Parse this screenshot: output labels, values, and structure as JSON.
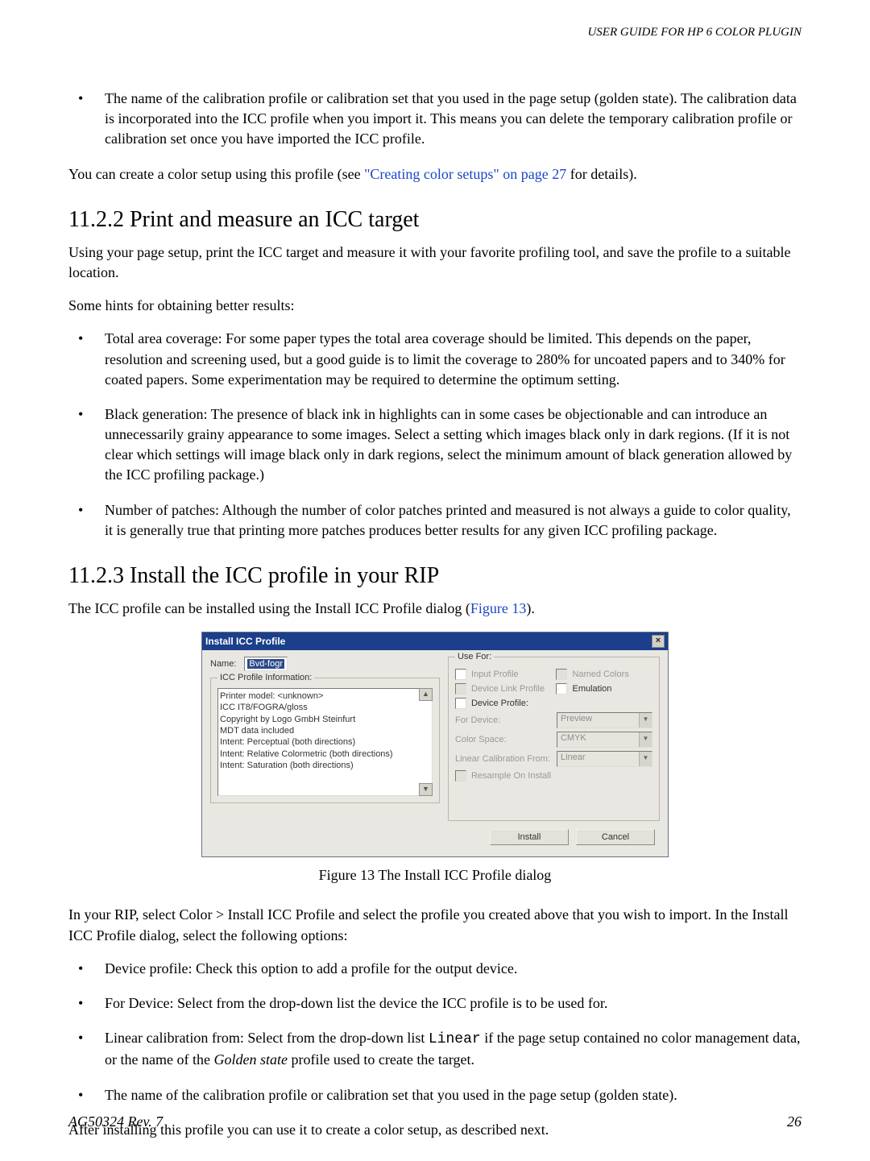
{
  "running_header": "USER GUIDE FOR HP 6 COLOR PLUGIN",
  "intro_bullet": "The name of the calibration profile or calibration set that you used in the page setup (golden state). The calibration data is incorporated into the ICC profile when you import it. This means you can delete the temporary calibration profile or calibration set once you have imported the ICC profile.",
  "create_setup_pre": "You can create a color setup using this profile (see ",
  "create_setup_link": "\"Creating color setups\" on page 27",
  "create_setup_post": " for details).",
  "sec_1122_title": "11.2.2   Print and measure an ICC target",
  "sec_1122_p1": "Using your page setup, print the ICC target and measure it with your favorite profiling tool, and save the profile to a suitable location.",
  "sec_1122_p2": "Some hints for obtaining better results:",
  "sec_1122_bullets": [
    "Total area coverage: For some paper types the total area coverage should be limited. This depends on the paper, resolution and screening used, but a good guide is to limit the coverage to 280% for uncoated papers and to 340% for coated papers. Some experimentation may be required to determine the optimum setting.",
    "Black generation: The presence of black ink in highlights can in some cases be objectionable and can introduce an unnecessarily grainy appearance to some images. Select a setting which images black only in dark regions. (If it is not clear which settings will image black only in dark regions, select the minimum amount of black generation allowed by the ICC profiling package.)",
    "Number of patches: Although the number of color patches printed and measured is not always a guide to color quality, it is generally true that printing more patches produces better results for any given ICC profiling package."
  ],
  "sec_1123_title": "11.2.3   Install the ICC profile in your RIP",
  "sec_1123_p1_pre": "The ICC profile can be installed using the Install ICC Profile dialog (",
  "sec_1123_p1_link": "Figure 13",
  "sec_1123_p1_post": ").",
  "dialog": {
    "title": "Install ICC Profile",
    "name_label": "Name:",
    "name_value": "Bvd-fogr",
    "icc_group_legend": "ICC Profile Information:",
    "icc_info_lines": [
      "Printer model: <unknown>",
      "ICC IT8/FOGRA/gloss",
      "Copyright by Logo GmbH Steinfurt",
      "MDT data included",
      "Intent: Perceptual (both directions)",
      "Intent: Relative Colormetric (both directions)",
      "Intent: Saturation (both directions)"
    ],
    "use_for_legend": "Use For:",
    "input_profile": "Input Profile",
    "named_colors": "Named Colors",
    "device_link_profile": "Device Link Profile",
    "emulation": "Emulation",
    "device_profile": "Device Profile:",
    "for_device_label": "For Device:",
    "for_device_value": "Preview",
    "color_space_label": "Color Space:",
    "color_space_value": "CMYK",
    "linear_cal_label": "Linear Calibration From:",
    "linear_cal_value": "Linear",
    "resample": "Resample On Install",
    "install_btn": "Install",
    "cancel_btn": "Cancel"
  },
  "figure_caption": "Figure 13    The Install ICC Profile dialog",
  "sec_1123_p2": "In your RIP, select Color > Install ICC Profile and select the profile you created above that you wish to import. In the Install ICC Profile dialog, select the following options:",
  "sec_1123_bullets": {
    "b1": "Device profile: Check this option to add a profile for the output device.",
    "b2": "For Device: Select from the drop-down list the device the ICC profile is to be used for.",
    "b3_pre": "Linear calibration from: Select from the drop-down list ",
    "b3_code": "Linear",
    "b3_mid": " if the page setup contained no color management data, or the name of the ",
    "b3_italic": "Golden state",
    "b3_post": " profile used to create the target.",
    "b4": "The name of the calibration profile or calibration set that you used in the page setup (golden state)."
  },
  "sec_1123_p3": "After installing this profile you can use it to create a color setup, as described next.",
  "footer_left": "AG50324 Rev. 7",
  "footer_right": "26"
}
